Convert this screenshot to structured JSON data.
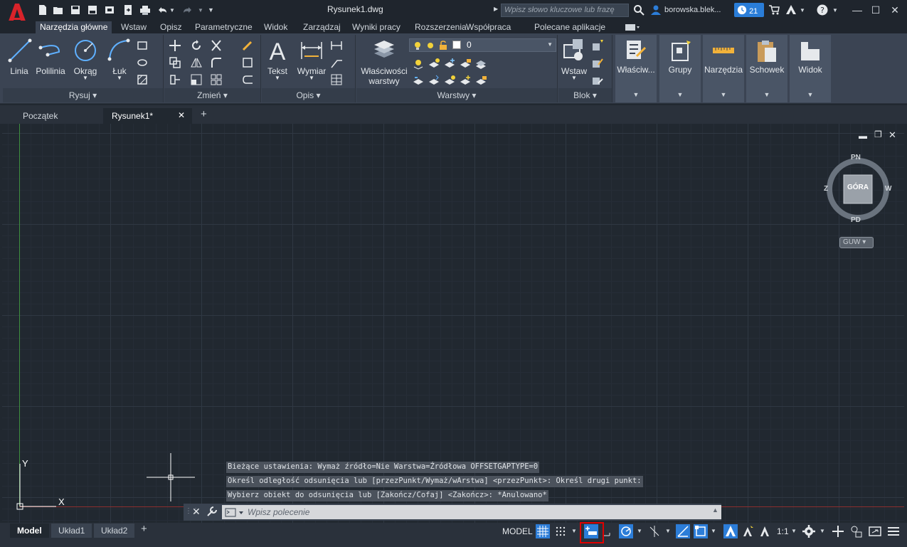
{
  "window": {
    "title": "Rysunek1.dwg",
    "search_placeholder": "Wpisz słowo kluczowe lub frazę",
    "user": "borowska.blek...",
    "notifications": "21"
  },
  "ribbon_tabs": [
    "Narzędzia główne",
    "Wstaw",
    "Opisz",
    "Parametryczne",
    "Widok",
    "Zarządzaj",
    "Wyniki pracy",
    "Rozszerzenia",
    "Współpraca",
    "Polecane aplikacje"
  ],
  "ribbon": {
    "draw": {
      "title": "Rysuj",
      "line": "Linia",
      "polyline": "Polilinia",
      "circle": "Okrąg",
      "arc": "Łuk"
    },
    "modify": {
      "title": "Zmień"
    },
    "annotation": {
      "title": "Opis",
      "text": "Tekst",
      "dimension": "Wymiar"
    },
    "layers": {
      "title": "Warstwy",
      "props": "Właściwości warstwy",
      "props_line1": "Właściwości",
      "props_line2": "warstwy",
      "current_layer": "0"
    },
    "block": {
      "title": "Blok",
      "insert": "Wstaw"
    },
    "collapsed": [
      "Właściw...",
      "Grupy",
      "Narzędzia",
      "Schowek",
      "Widok"
    ]
  },
  "doc_tabs": [
    "Początek",
    "Rysunek1*"
  ],
  "viewcube": {
    "top": "GÓRA",
    "n": "PN",
    "s": "PD",
    "w": "Z",
    "e": "W",
    "ucs": "GUW"
  },
  "ucs_icon": {
    "x": "X",
    "y": "Y"
  },
  "command_history": [
    "Bieżące ustawienia: Wymaż źródło=Nie Warstwa=Źródłowa OFFSETGAPTYPE=0",
    "Określ odległość odsunięcia lub [przezPunkt/Wymaż/wArstwa] <przezPunkt>:  Określ drugi punkt:",
    "Wybierz obiekt do odsunięcia lub [Zakończ/Cofaj] <Zakończ>: *Anulowano*"
  ],
  "command_placeholder": "Wpisz polecenie",
  "layout_tabs": [
    "Model",
    "Układ1",
    "Układ2"
  ],
  "status": {
    "model": "MODEL",
    "scale": "1:1"
  },
  "colors": {
    "accent": "#2c7dd8",
    "background": "#212830",
    "highlight": "#e00000"
  }
}
